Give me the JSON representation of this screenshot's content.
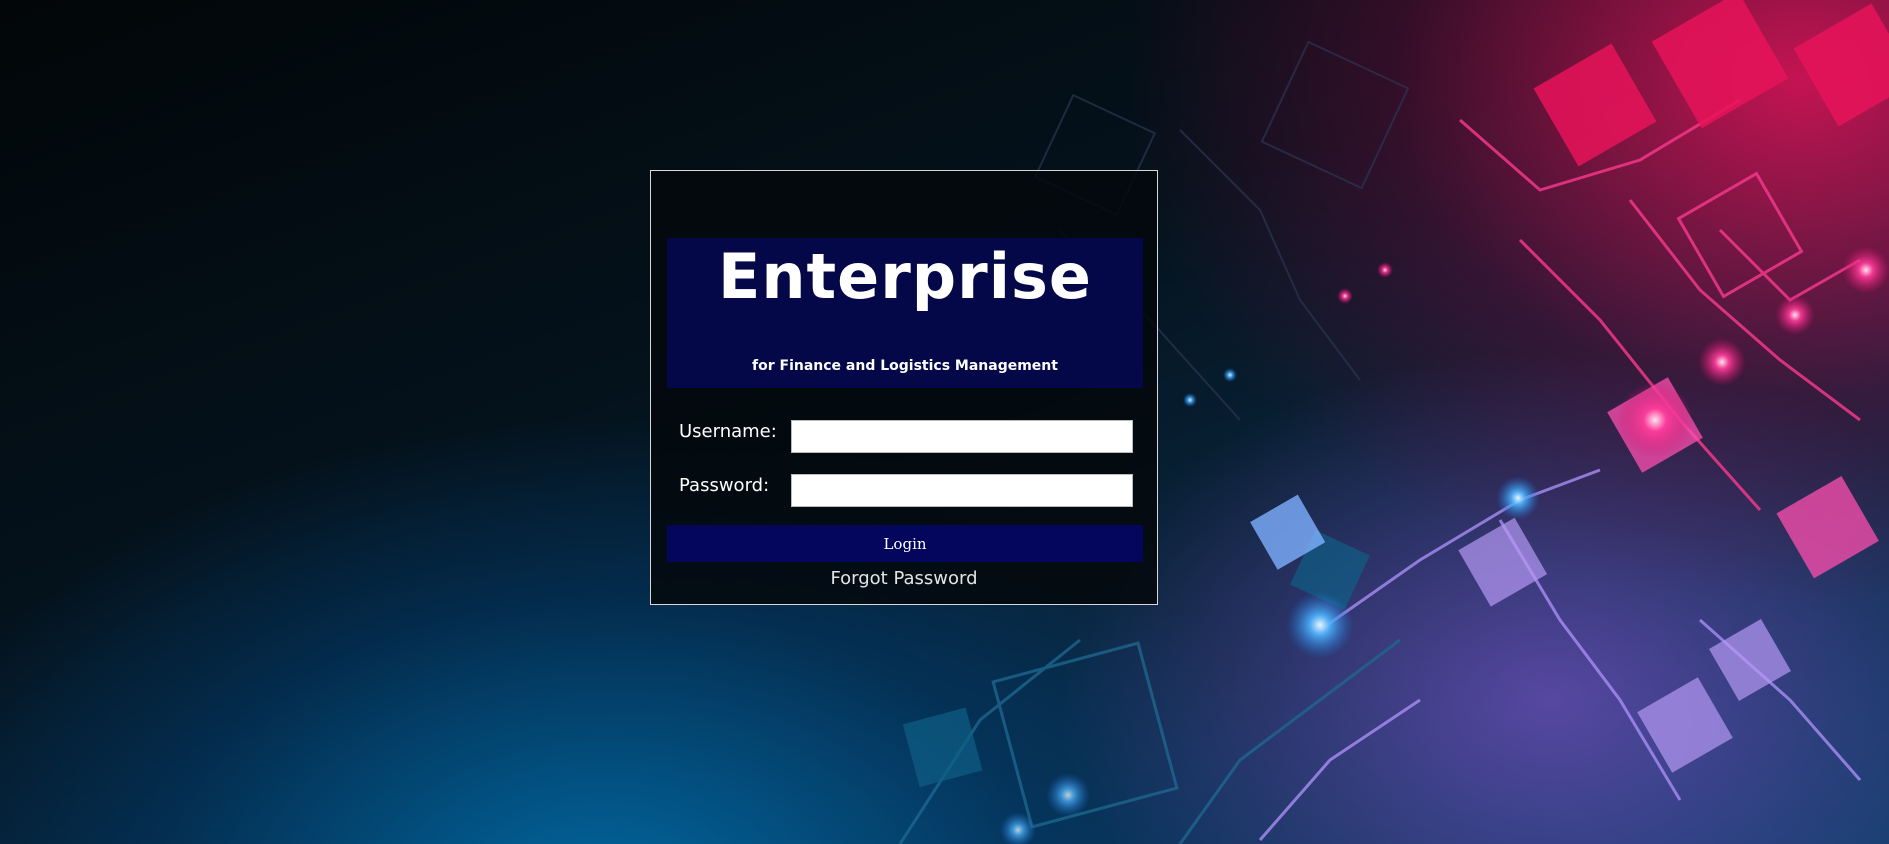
{
  "login": {
    "title": "Enterprise",
    "subtitle": "for Finance and Logistics Management",
    "username_label": "Username:",
    "username_value": "",
    "password_label": "Password:",
    "password_value": "",
    "login_button": "Login",
    "forgot_password": "Forgot Password"
  },
  "colors": {
    "banner": "#040848",
    "login_button": "#04065e",
    "box_border": "#d8d8d8",
    "accent_pink": "#e8135a",
    "accent_blue": "#1b7fc4"
  },
  "background": {
    "icon": "circuit-network-graphic"
  }
}
